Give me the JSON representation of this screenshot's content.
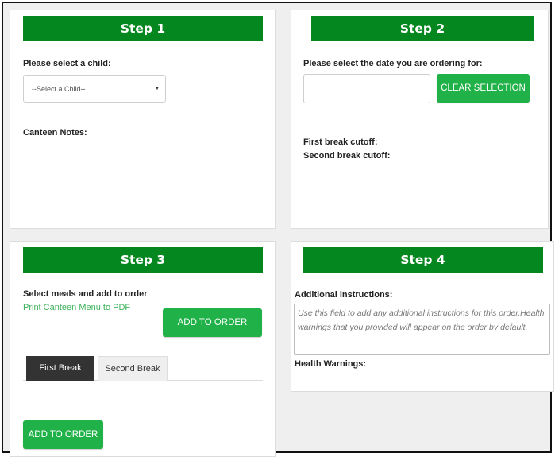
{
  "step1": {
    "header": "Step 1",
    "child_label": "Please select a child:",
    "child_select_value": "--Select a Child--",
    "notes_label": "Canteen Notes:"
  },
  "step2": {
    "header": "Step 2",
    "date_label": "Please select the date you are ordering for:",
    "date_value": "",
    "clear_button": "CLEAR SELECTION",
    "first_break_cutoff": "First break cutoff:",
    "second_break_cutoff": "Second break cutoff:"
  },
  "step3": {
    "header": "Step 3",
    "instruction": "Select meals and add to order",
    "print_link": "Print Canteen Menu to PDF",
    "add_button_top": "ADD TO ORDER",
    "tabs": [
      {
        "label": "First Break",
        "active": true
      },
      {
        "label": "Second Break",
        "active": false
      }
    ],
    "add_button_bottom": "ADD TO ORDER"
  },
  "step4": {
    "header": "Step 4",
    "instructions_label": "Additional instructions:",
    "instructions_placeholder": "Use this field to add any additional instructions for this order,Health warnings that you provided will appear on the order by default.",
    "health_label": "Health Warnings:"
  },
  "colors": {
    "header_green": "#05871f",
    "button_green": "#20b248",
    "link_green": "#3db35a",
    "tab_active_bg": "#333333"
  }
}
